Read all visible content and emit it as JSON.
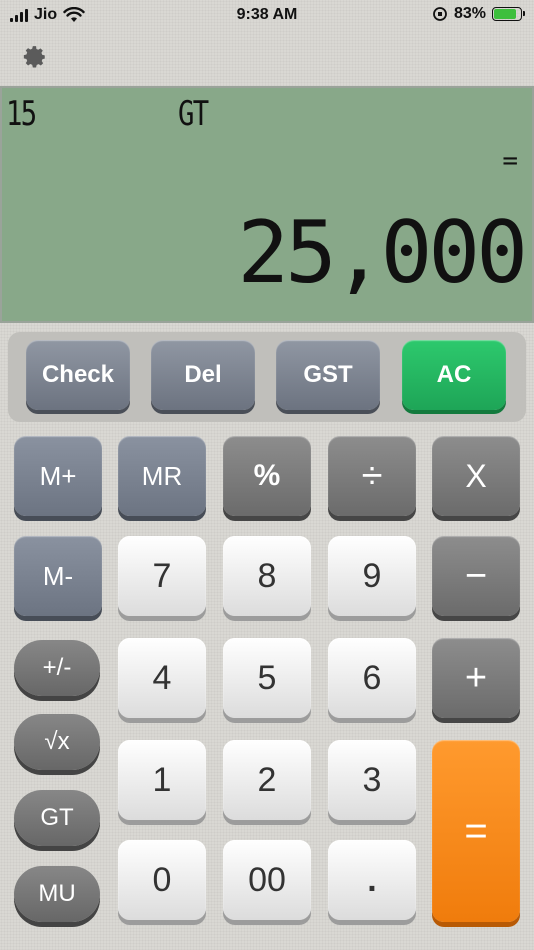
{
  "status_bar": {
    "carrier": "Jio",
    "time": "9:38 AM",
    "battery_percent": "83%",
    "battery_level": 0.83
  },
  "display": {
    "count": "15",
    "gt_indicator": "GT",
    "operator": "=",
    "value": "25,000"
  },
  "top_buttons": {
    "check": "Check",
    "del": "Del",
    "gst": "GST",
    "ac": "AC"
  },
  "keys": {
    "m_plus": "M+",
    "mr": "MR",
    "percent": "%",
    "divide": "÷",
    "multiply": "X",
    "m_minus": "M-",
    "seven": "7",
    "eight": "8",
    "nine": "9",
    "minus": "−",
    "plus_minus": "+/-",
    "four": "4",
    "five": "5",
    "six": "6",
    "plus": "+",
    "sqrt": "√x",
    "one": "1",
    "two": "2",
    "three": "3",
    "equals": "=",
    "gt": "GT",
    "mu": "MU",
    "zero": "0",
    "double_zero": "00",
    "decimal": "."
  },
  "colors": {
    "lcd_bg": "#88a889",
    "ac_button": "#22b85f",
    "equals_button": "#f58a1b"
  }
}
